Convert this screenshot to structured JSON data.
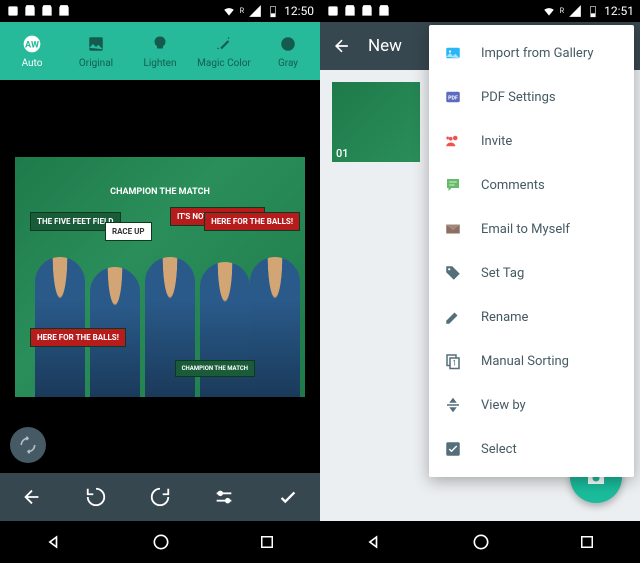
{
  "left": {
    "status": {
      "time": "12:50"
    },
    "filters": [
      {
        "label": "Auto",
        "icon": "auto"
      },
      {
        "label": "Original",
        "icon": "image"
      },
      {
        "label": "Lighten",
        "icon": "bulb"
      },
      {
        "label": "Magic Color",
        "icon": "wand"
      },
      {
        "label": "Gray",
        "icon": "gray"
      }
    ],
    "photo": {
      "banner": "CHAMPION THE MATCH",
      "signs": {
        "field": "THE FIVE FEET\nFIELD",
        "race": "RACE UP",
        "foos": "IT'S NOT\nFOOS\nDADDY",
        "balls1": "HERE FOR THE\nBALLS!",
        "balls2": "HERE FOR THE\nBALLS!",
        "champ": "CHAMPION\nTHE MATCH"
      }
    }
  },
  "right": {
    "status": {
      "time": "12:51"
    },
    "appbar": {
      "title": "New"
    },
    "thumb": {
      "num": "01"
    },
    "menu": [
      {
        "label": "Import from Gallery",
        "icon": "gallery",
        "color": "#29b6f6"
      },
      {
        "label": "PDF Settings",
        "icon": "pdf",
        "color": "#5c6bc0"
      },
      {
        "label": "Invite",
        "icon": "invite",
        "color": "#ef5350"
      },
      {
        "label": "Comments",
        "icon": "comment",
        "color": "#66bb6a"
      },
      {
        "label": "Email to Myself",
        "icon": "email",
        "color": "#8d6e63"
      },
      {
        "label": "Set Tag",
        "icon": "tag",
        "color": "#546e7a"
      },
      {
        "label": "Rename",
        "icon": "pencil",
        "color": "#546e7a"
      },
      {
        "label": "Manual Sorting",
        "icon": "sort",
        "color": "#546e7a"
      },
      {
        "label": "View by",
        "icon": "viewby",
        "color": "#546e7a"
      },
      {
        "label": "Select",
        "icon": "check",
        "color": "#546e7a"
      }
    ]
  }
}
